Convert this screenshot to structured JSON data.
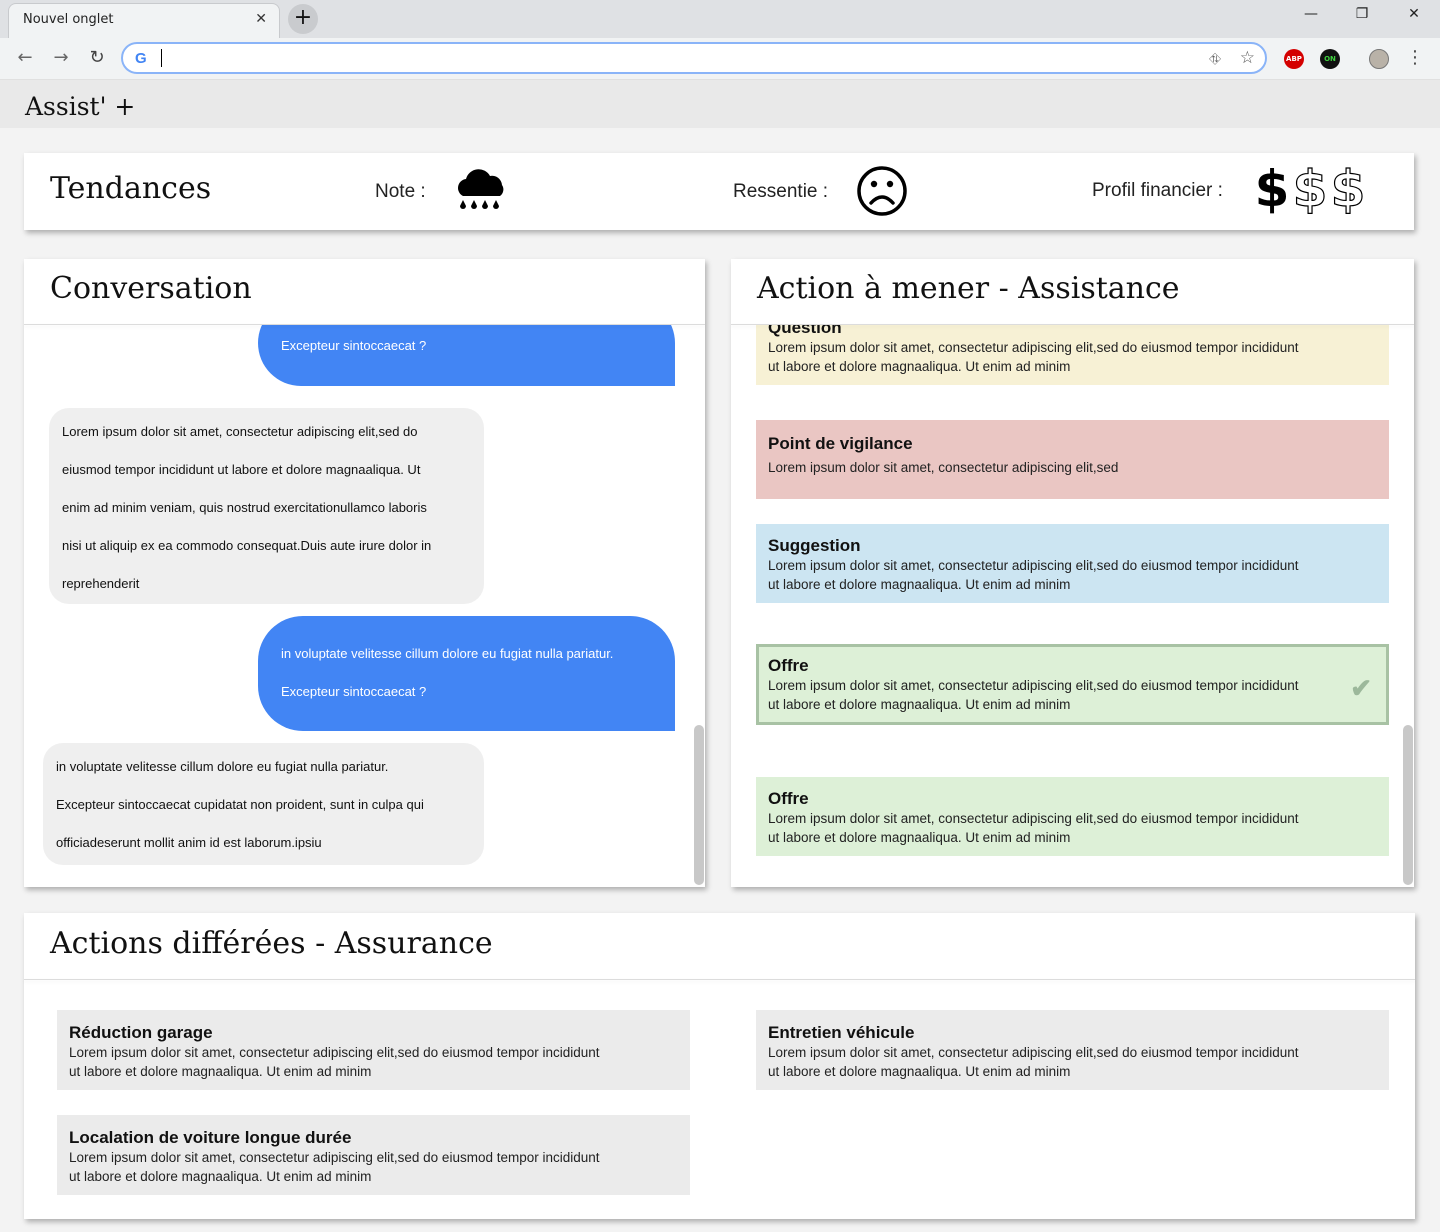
{
  "browser": {
    "tab_title": "Nouvel onglet",
    "tab_close": "✕",
    "new_tab": "+",
    "minimize": "—",
    "restore": "❐",
    "close": "✕",
    "back": "←",
    "forward": "→",
    "reload": "↻",
    "address_value": "",
    "g_logo": "G",
    "translate_icon": "⛗",
    "star_icon": "☆",
    "ext_abp": "ABP",
    "ext_on": "ON",
    "menu_icon": "⋮"
  },
  "app": {
    "title": "Assist' +"
  },
  "tendances": {
    "title": "Tendances",
    "note_label": "Note :",
    "ressentie_label": "Ressentie :",
    "profil_label": "Profil financier :",
    "dollar_symbol": "$",
    "financial_level": 1,
    "financial_max": 3
  },
  "conversation": {
    "title": "Conversation",
    "messages": [
      {
        "side": "right",
        "lines": [
          "Excepteur sintoccaecat ?"
        ]
      },
      {
        "side": "left",
        "lines": [
          "Lorem ipsum dolor sit amet, consectetur adipiscing elit,sed do",
          "eiusmod tempor incididunt ut labore et dolore magnaaliqua. Ut",
          "enim ad minim veniam, quis nostrud exercitationullamco laboris",
          "nisi ut aliquip ex ea commodo consequat.Duis aute irure dolor in",
          "reprehenderit"
        ]
      },
      {
        "side": "right",
        "lines": [
          "in voluptate velitesse cillum dolore eu fugiat nulla pariatur.",
          "Excepteur sintoccaecat ?"
        ]
      },
      {
        "side": "left",
        "lines": [
          "in voluptate velitesse cillum dolore eu fugiat nulla pariatur.",
          "Excepteur sintoccaecat cupidatat non proident, sunt in culpa qui",
          "officiadeserunt mollit anim id est laborum.ipsiu"
        ]
      }
    ]
  },
  "actions": {
    "title": "Action à mener - Assistance",
    "items": [
      {
        "title": "Question",
        "line1": "Lorem ipsum dolor sit amet, consectetur adipiscing elit,sed do eiusmod tempor incididunt",
        "line2": "ut labore et dolore magnaaliqua. Ut enim ad minim",
        "color": "#f7f1d5"
      },
      {
        "title": "Point de vigilance",
        "line1": "Lorem ipsum dolor sit amet, consectetur adipiscing elit,sed",
        "line2": "",
        "color": "#eac6c3"
      },
      {
        "title": "Suggestion",
        "line1": "Lorem ipsum dolor sit amet, consectetur adipiscing elit,sed do eiusmod tempor incididunt",
        "line2": "ut labore et dolore magnaaliqua. Ut enim ad minim",
        "color": "#cce5f2"
      },
      {
        "title": "Offre",
        "line1": "Lorem ipsum dolor sit amet, consectetur adipiscing elit,sed do eiusmod tempor incididunt",
        "line2": "ut labore et dolore magnaaliqua. Ut enim ad minim",
        "color": "#ddf0d7",
        "selected": true,
        "check": "✔"
      },
      {
        "title": "Offre",
        "line1": "Lorem ipsum dolor sit amet, consectetur adipiscing elit,sed do eiusmod tempor incididunt",
        "line2": "ut labore et dolore magnaaliqua. Ut enim ad minim",
        "color": "#ddf0d7"
      }
    ]
  },
  "deferred": {
    "title": "Actions différées - Assurance",
    "items": [
      {
        "title": "Réduction garage",
        "line1": "Lorem ipsum dolor sit amet, consectetur adipiscing elit,sed do eiusmod tempor incididunt",
        "line2": "ut labore et dolore magnaaliqua. Ut enim ad minim"
      },
      {
        "title": "Entretien véhicule",
        "line1": "Lorem ipsum dolor sit amet, consectetur adipiscing elit,sed do eiusmod tempor incididunt",
        "line2": "ut labore et dolore magnaaliqua. Ut enim ad minim"
      },
      {
        "title": "Localation de voiture longue durée",
        "line1": "Lorem ipsum dolor sit amet, consectetur adipiscing elit,sed do eiusmod tempor incididunt",
        "line2": "ut labore et dolore magnaaliqua. Ut enim ad minim"
      }
    ],
    "box_color": "#ebebeb"
  }
}
